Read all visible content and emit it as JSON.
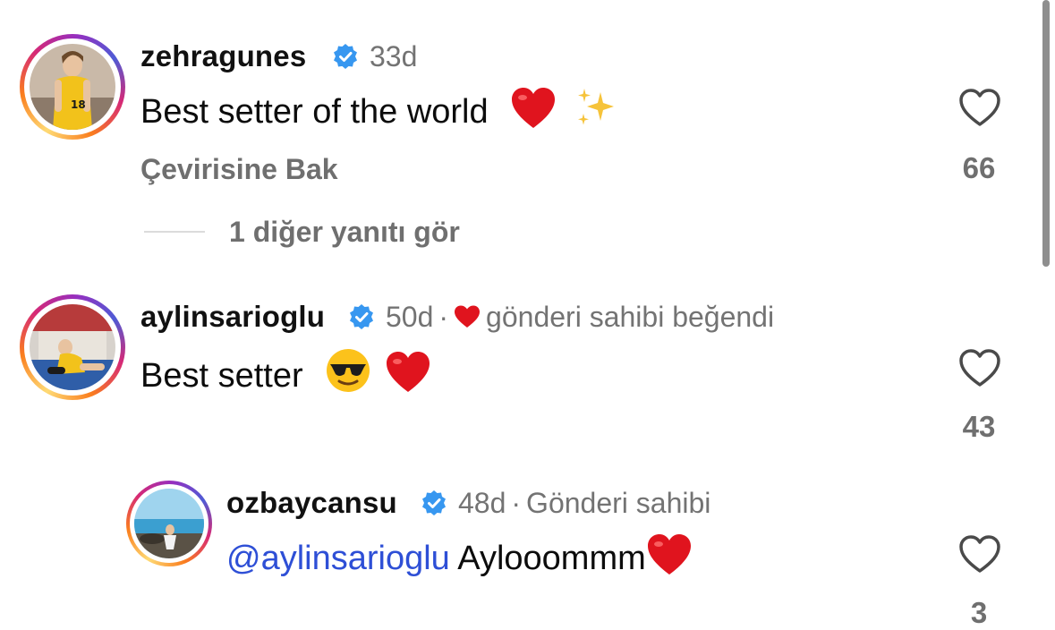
{
  "comments": [
    {
      "username": "zehragunes",
      "age": "33d",
      "text": "Best setter of the world",
      "emoji": [
        "heart-emoji",
        "sparkles-emoji"
      ],
      "translate_label": "Çevirisine Bak",
      "likes": "66",
      "view_replies": "1 diğer yanıtı gör"
    },
    {
      "username": "aylinsarioglu",
      "age": "50d",
      "separator": "·",
      "liked_by_author": "gönderi sahibi beğendi",
      "text": "Best setter",
      "emoji": [
        "sunglasses-emoji",
        "heart-emoji"
      ],
      "likes": "43"
    },
    {
      "username": "ozbaycansu",
      "age": "48d",
      "separator": "·",
      "author_badge": "Gönderi sahibi",
      "mention": "@aylinsarioglu",
      "text": "Aylooommm",
      "emoji": [
        "heart-emoji"
      ],
      "likes": "3"
    }
  ],
  "colors": {
    "verified_badge": "#3797f0",
    "mention": "#2e4fd6",
    "heart_emoji": "#e0141e",
    "secondary_text": "#737373"
  }
}
